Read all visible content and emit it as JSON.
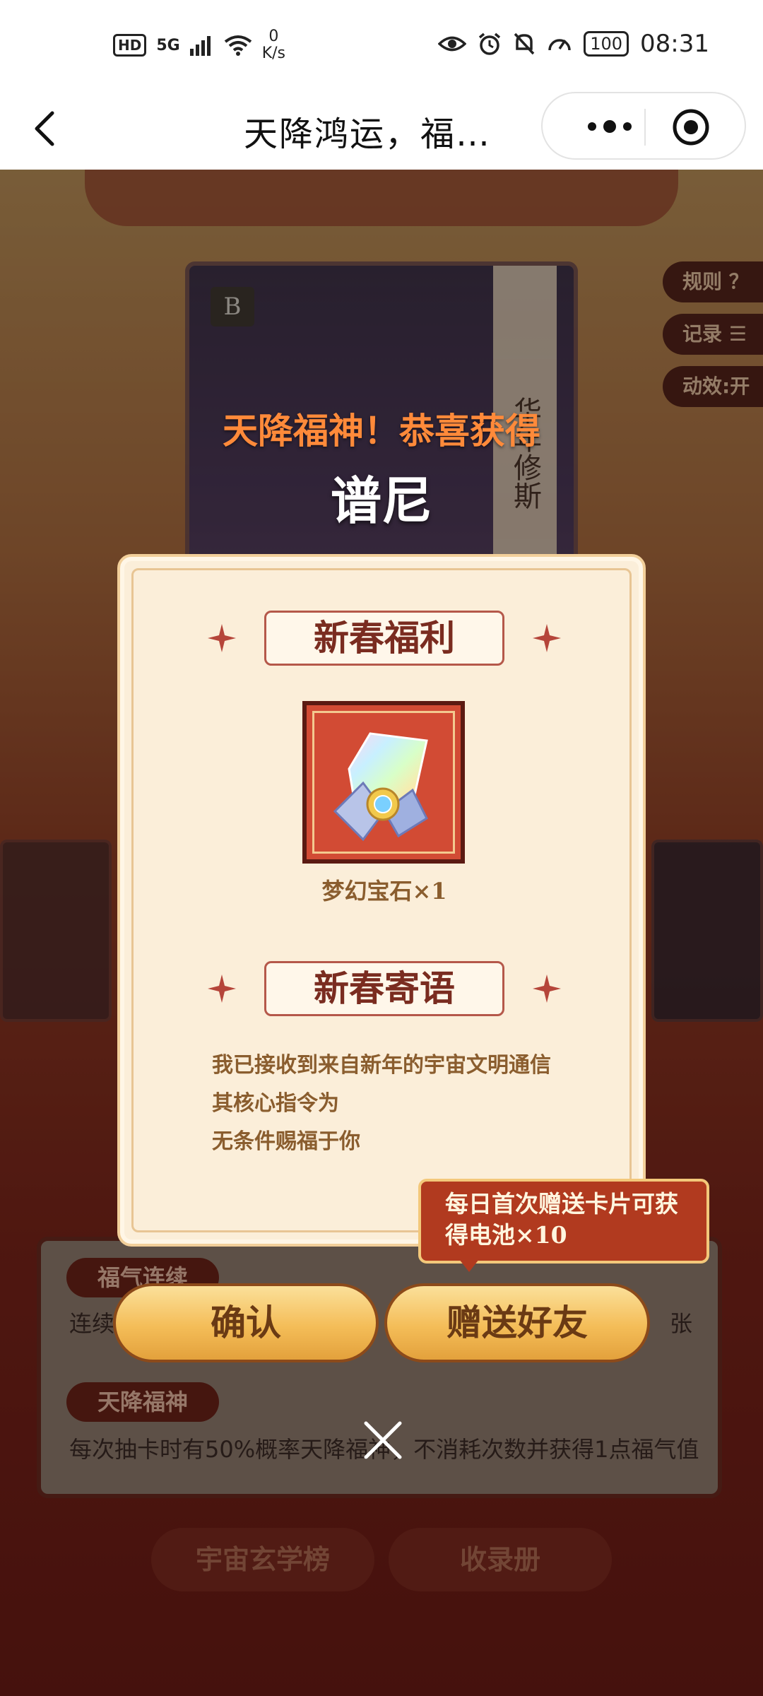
{
  "status_bar": {
    "hd": "HD",
    "network": "5G",
    "speed_value": "0",
    "speed_unit": "K/s",
    "battery": "100",
    "time": "08:31"
  },
  "nav": {
    "title": "天降鸿运，福…"
  },
  "game": {
    "card_badge": "B",
    "card_banner": "华年修斯",
    "win_title": "天降福神！恭喜获得",
    "win_name": "谱尼",
    "side_buttons": {
      "rules": "规则 ？",
      "records": "记录",
      "effects": "动效:开"
    },
    "rules_panel": {
      "tag1": "福气连续",
      "text1": "连续",
      "text1_tail": "张",
      "tag2": "天降福神",
      "text2": "每次抽卡时有50%概率天降福神，不消耗次数并获得1点福气值"
    },
    "bottom_buttons": {
      "ranking": "宇宙玄学榜",
      "collection": "收录册"
    }
  },
  "modal": {
    "section1_title": "新春福利",
    "prize_caption": "梦幻宝石×1",
    "section2_title": "新春寄语",
    "message_lines": [
      "我已接收到来自新年的宇宙文明通信",
      "其核心指令为",
      "无条件赐福于你"
    ],
    "tooltip_line1": "每日首次赠送卡片可获",
    "tooltip_line2": "得电池×10",
    "confirm_label": "确认",
    "gift_label": "赠送好友"
  },
  "colors": {
    "modal_bg": "#fbeed9",
    "accent_red": "#b5584a",
    "gold_button": "#f4bd58",
    "tooltip_bg": "#b13a1f"
  }
}
